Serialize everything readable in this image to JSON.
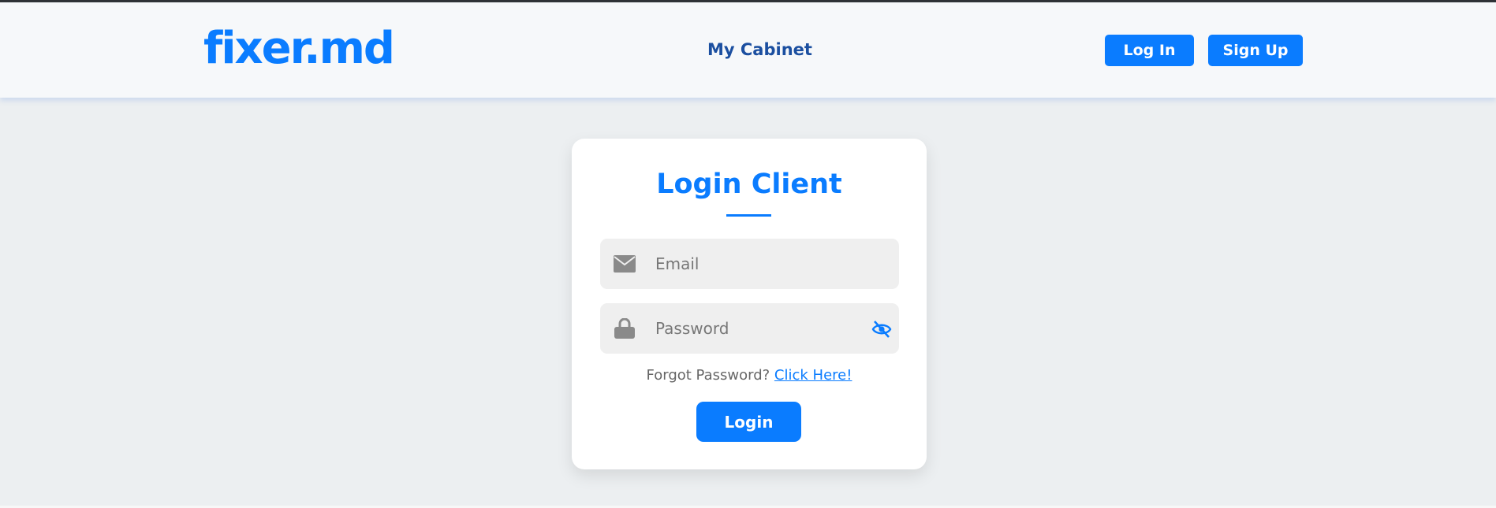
{
  "header": {
    "logo_text": "fixer.md",
    "nav_link": "My Cabinet",
    "login_button": "Log In",
    "signup_button": "Sign Up"
  },
  "login_form": {
    "title": "Login Client",
    "email_placeholder": "Email",
    "password_placeholder": "Password",
    "forgot_text": "Forgot Password?",
    "forgot_link": "Click Here!",
    "submit_button": "Login"
  },
  "icons": {
    "email": "envelope-icon",
    "password": "lock-icon",
    "toggle": "eye-slash-icon"
  },
  "colors": {
    "accent": "#0a7cff",
    "nav_text": "#1b4fa0",
    "page_bg": "#eceff1",
    "header_bg": "#f6f8fa",
    "field_bg": "#efefef"
  }
}
